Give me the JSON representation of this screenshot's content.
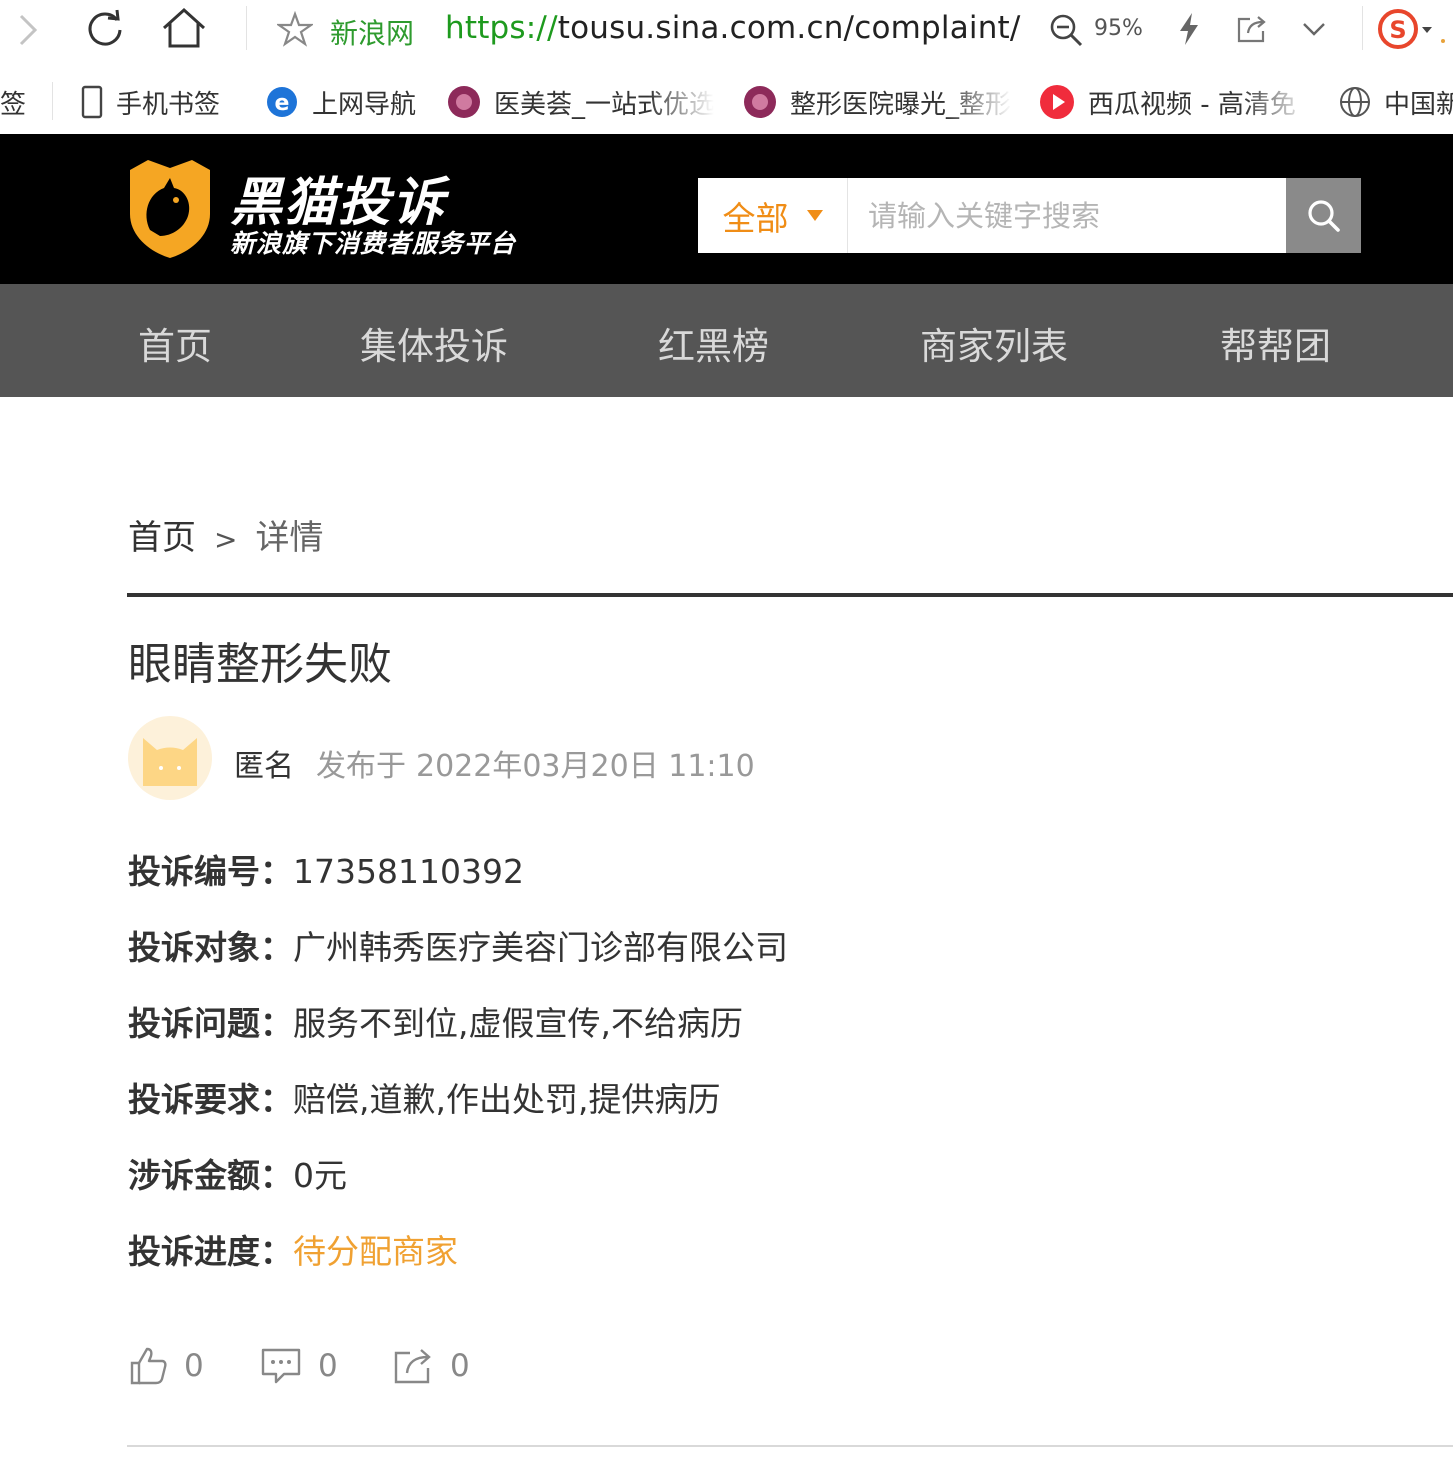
{
  "browser": {
    "site_name": "新浪网",
    "url_scheme": "https://",
    "url_rest": "tousu.sina.com.cn/complaint/",
    "zoom": "95%"
  },
  "bookmarks": [
    {
      "label": "签",
      "icon": "bookmark-icon"
    },
    {
      "label": "手机书签",
      "icon": "phone-icon"
    },
    {
      "label": "上网导航",
      "icon": "ie-icon"
    },
    {
      "label": "医美荟_一站式优选",
      "icon": "yimeihui-icon"
    },
    {
      "label": "整形医院曝光_整形",
      "icon": "yimeihui-icon"
    },
    {
      "label": "西瓜视频 - 高清免",
      "icon": "xigua-icon"
    },
    {
      "label": "中国新",
      "icon": "globe-icon"
    }
  ],
  "header": {
    "logo_title": "黑猫投诉",
    "logo_subtitle": "新浪旗下消费者服务平台",
    "search_category": "全部",
    "search_placeholder": "请输入关键字搜索"
  },
  "nav": {
    "items": [
      "首页",
      "集体投诉",
      "红黑榜",
      "商家列表",
      "帮帮团"
    ]
  },
  "breadcrumb": {
    "home": "首页",
    "separator": ">",
    "current": "详情"
  },
  "complaint": {
    "title": "眼睛整形失败",
    "author": "匿名",
    "posted_prefix": "发布于",
    "posted_time": "2022年03月20日 11:10",
    "fields": [
      {
        "label": "投诉编号：",
        "value": "17358110392"
      },
      {
        "label": "投诉对象：",
        "value": "广州韩秀医疗美容门诊部有限公司"
      },
      {
        "label": "投诉问题：",
        "value": "服务不到位,虚假宣传,不给病历"
      },
      {
        "label": "投诉要求：",
        "value": "赔偿,道歉,作出处罚,提供病历"
      },
      {
        "label": "涉诉金额：",
        "value": "0元"
      },
      {
        "label": "投诉进度：",
        "value": "待分配商家"
      }
    ],
    "status_color": "#f0a132",
    "actions": {
      "likes": "0",
      "comments": "0",
      "shares": "0"
    }
  },
  "colors": {
    "header_bg": "#000000",
    "nav_bg": "#555555",
    "accent": "#f08d16"
  }
}
